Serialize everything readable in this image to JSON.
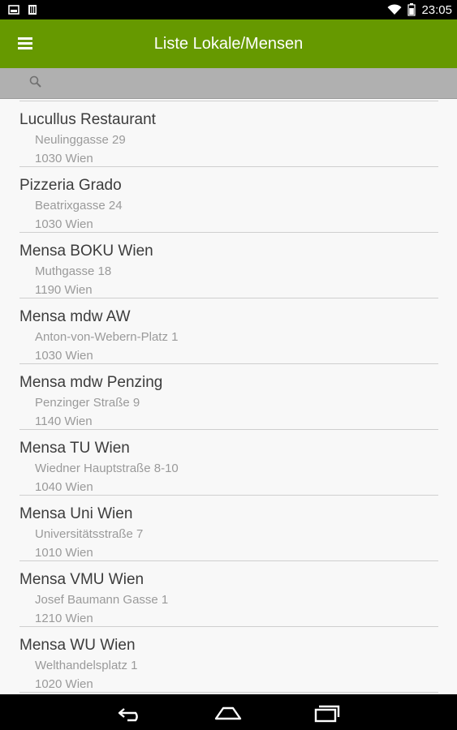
{
  "status_bar": {
    "time": "23:05",
    "icons": [
      "screenshot-icon",
      "sim-card-icon",
      "wifi-icon",
      "battery-icon"
    ]
  },
  "action_bar": {
    "title": "Liste Lokale/Mensen",
    "menu_icon": "hamburger-menu-icon",
    "background": "#669900"
  },
  "search": {
    "placeholder": "",
    "value": "",
    "icon": "search-icon"
  },
  "restaurants": [
    {
      "name": "Lucullus Restaurant",
      "street": "Neulinggasse 29",
      "city": "1030 Wien"
    },
    {
      "name": "Pizzeria Grado",
      "street": "Beatrixgasse 24",
      "city": "1030 Wien"
    },
    {
      "name": "Mensa BOKU Wien",
      "street": "Muthgasse 18",
      "city": "1190 Wien"
    },
    {
      "name": "Mensa mdw AW",
      "street": "Anton-von-Webern-Platz 1",
      "city": "1030 Wien"
    },
    {
      "name": "Mensa mdw Penzing",
      "street": "Penzinger Straße 9",
      "city": "1140 Wien"
    },
    {
      "name": "Mensa TU Wien",
      "street": "Wiedner Hauptstraße 8-10",
      "city": "1040 Wien"
    },
    {
      "name": "Mensa Uni Wien",
      "street": "Universitätsstraße 7",
      "city": "1010 Wien"
    },
    {
      "name": "Mensa VMU Wien",
      "street": "Josef Baumann Gasse 1",
      "city": "1210 Wien"
    },
    {
      "name": "Mensa WU Wien",
      "street": "Welthandelsplatz 1",
      "city": "1020 Wien"
    }
  ],
  "nav_bar": {
    "buttons": [
      "back-icon",
      "home-icon",
      "recent-apps-icon"
    ]
  }
}
